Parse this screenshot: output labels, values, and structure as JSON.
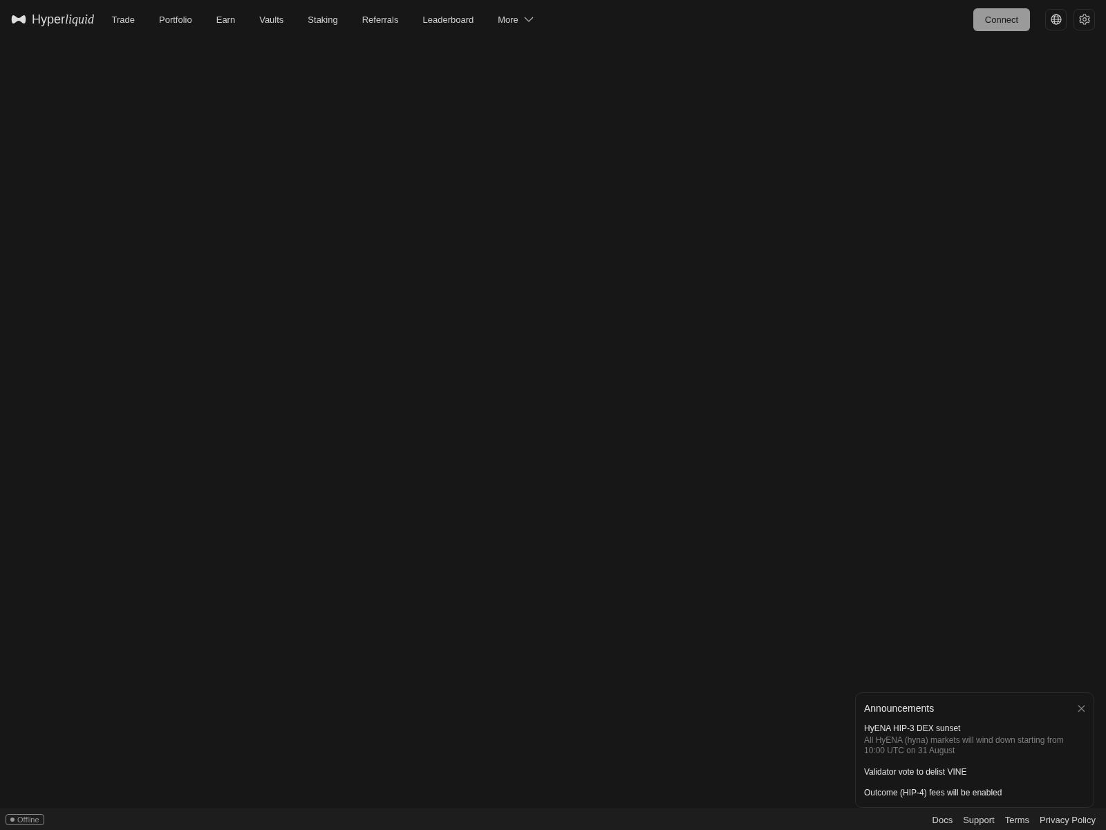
{
  "header": {
    "logo": {
      "plain": "Hyper",
      "italic": "liquid"
    },
    "nav": [
      {
        "label": "Trade"
      },
      {
        "label": "Portfolio"
      },
      {
        "label": "Earn"
      },
      {
        "label": "Vaults"
      },
      {
        "label": "Staking"
      },
      {
        "label": "Referrals"
      },
      {
        "label": "Leaderboard"
      },
      {
        "label": "More",
        "dropdown": true
      }
    ],
    "connect_button": "Connect"
  },
  "announcements": {
    "title": "Announcements",
    "items": [
      {
        "title": "HyENA HIP-3 DEX sunset",
        "body": "All HyENA (hyna) markets will wind down starting from 10:00 UTC on 31 August"
      },
      {
        "title": "Validator vote to delist VINE"
      },
      {
        "title": "Outcome (HIP-4) fees will be enabled"
      }
    ]
  },
  "footer": {
    "status": "Offline",
    "links": [
      "Docs",
      "Support",
      "Terms",
      "Privacy Policy"
    ]
  }
}
